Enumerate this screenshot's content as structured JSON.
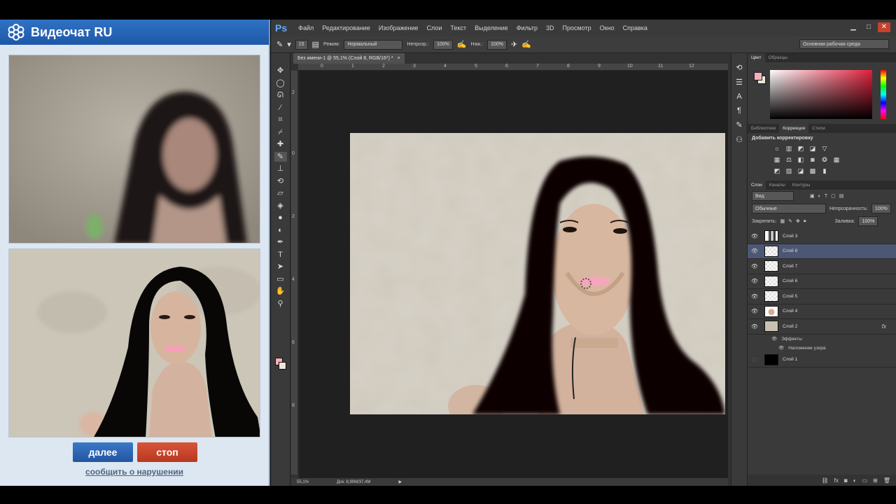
{
  "videochat": {
    "title": "Видеочат RU",
    "buttons": {
      "next": "далее",
      "stop": "стоп"
    },
    "report_link": "сообщить о нарушении"
  },
  "photoshop": {
    "logo": "Ps",
    "menu": [
      "Файл",
      "Редактирование",
      "Изображение",
      "Слои",
      "Текст",
      "Выделение",
      "Фильтр",
      "3D",
      "Просмотр",
      "Окно",
      "Справка"
    ],
    "options": {
      "brush_size": "15",
      "mode_label": "Режим:",
      "mode_value": "Нормальный",
      "opacity_label": "Непрозр.:",
      "opacity_value": "100%",
      "pressure_label": "Наж.:",
      "pressure_value": "100%",
      "workspace": "Основная рабочая среда"
    },
    "document_tab": "Без имени-1 @ 55,1% (Слой 8, RGB/16*) *",
    "ruler_numbers": [
      "0",
      "1",
      "2",
      "3",
      "4",
      "5",
      "6",
      "7",
      "8",
      "9",
      "10",
      "11",
      "12"
    ],
    "ruler_v_numbers": [
      "2",
      "0",
      "2",
      "4",
      "6",
      "8"
    ],
    "status": {
      "zoom": "55,1%",
      "doc": "Док: 8,90M/37,4M"
    },
    "colors": {
      "foreground": "#f3b0ba",
      "background": "#eee6d8",
      "accent": "#4c5775"
    },
    "panels": {
      "color_tabs": [
        "Цвет",
        "Образцы"
      ],
      "adjust_tabs": [
        "Библиотеки",
        "Коррекция",
        "Стили"
      ],
      "adjust_title": "Добавить корректировку",
      "layer_tabs": [
        "Слои",
        "Каналы",
        "Контуры"
      ],
      "filter_label": "Вид",
      "blend_mode": "Обычные",
      "opacity_label": "Непрозрачность:",
      "opacity_value": "100%",
      "lock_label": "Закрепить:",
      "fill_label": "Заливка:",
      "fill_value": "100%"
    },
    "layers": [
      {
        "name": "Слой 3",
        "thumb": "hair",
        "visible": true,
        "selected": false
      },
      {
        "name": "Слой 8",
        "thumb": "checker",
        "visible": true,
        "selected": true
      },
      {
        "name": "Слой 7",
        "thumb": "checker",
        "visible": true,
        "selected": false
      },
      {
        "name": "Слой 6",
        "thumb": "checker",
        "visible": true,
        "selected": false
      },
      {
        "name": "Слой 5",
        "thumb": "checker",
        "visible": true,
        "selected": false
      },
      {
        "name": "Слой 4",
        "thumb": "face",
        "visible": true,
        "selected": false
      },
      {
        "name": "Слой 2",
        "thumb": "beige",
        "visible": true,
        "selected": false,
        "fx": "fx",
        "effects_label": "Эффекты",
        "effect": "Наложение узора"
      },
      {
        "name": "Слой 1",
        "thumb": "black",
        "visible": false,
        "selected": false
      }
    ]
  }
}
